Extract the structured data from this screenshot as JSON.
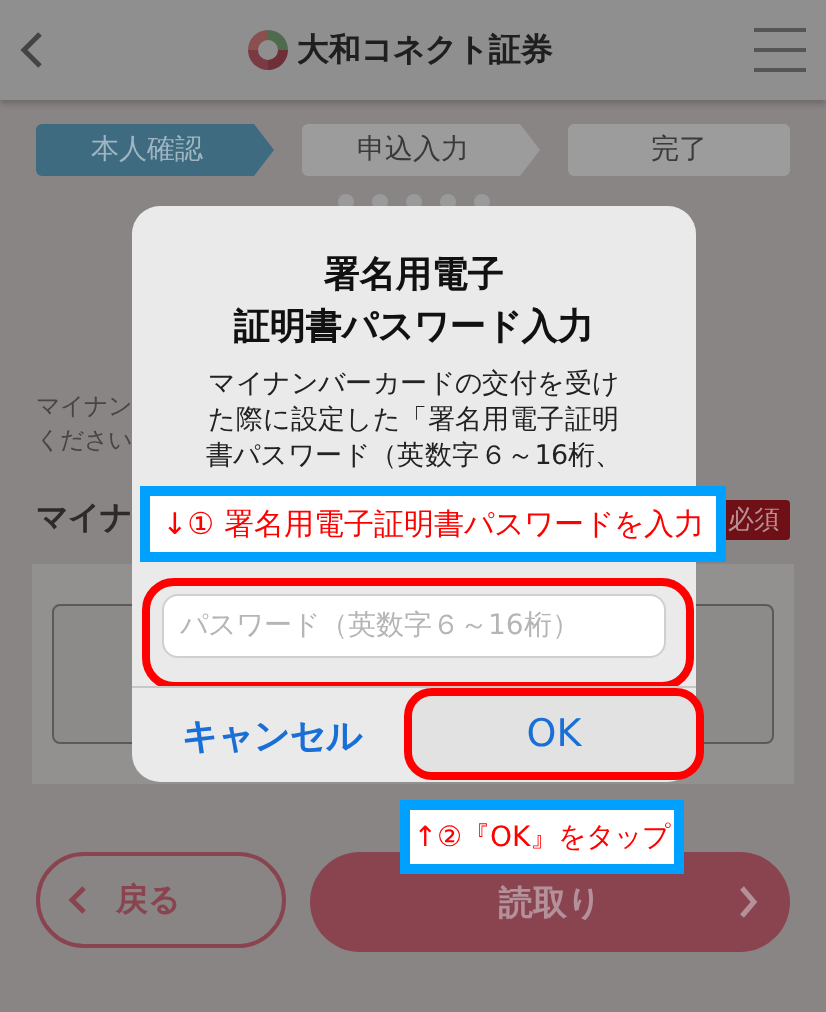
{
  "header": {
    "logo_text": "大和コネクト証券"
  },
  "steps": [
    {
      "label": "本人確認",
      "selected": true
    },
    {
      "label": "申込入力",
      "selected": false
    },
    {
      "label": "完了",
      "selected": false
    }
  ],
  "page": {
    "lines": [
      "マイナン",
      "ください"
    ],
    "heading": "マイナ",
    "required_badge": "必須"
  },
  "footer_buttons": {
    "back": "戻る",
    "read": "読取り"
  },
  "dialog": {
    "title_lines": [
      "署名用電子",
      "証明書パスワード入力"
    ],
    "description_lines": [
      "マイナンバーカードの交付を受け",
      "た際に設定した「署名用電子証明",
      "書パスワード（英数字６～16桁、"
    ],
    "placeholder": "パスワード（英数字６～16桁）",
    "cancel": "キャンセル",
    "ok": "OK"
  },
  "annotations": [
    {
      "text": "↓① 署名用電子証明書パスワードを入力"
    },
    {
      "text": "↑②『OK』をタップ"
    }
  ]
}
